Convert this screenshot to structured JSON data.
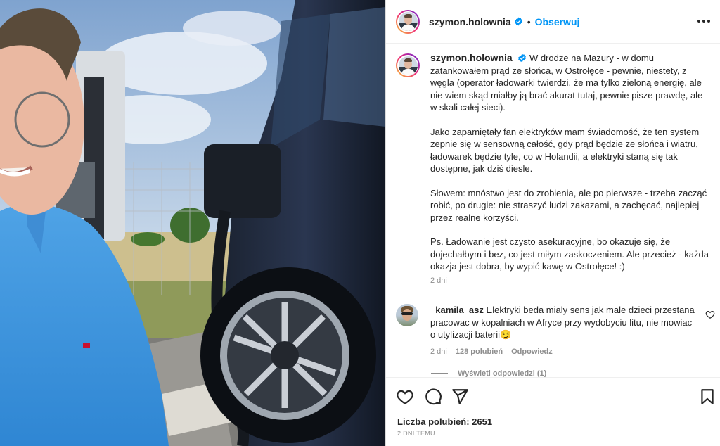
{
  "post": {
    "username": "szymon.holownia",
    "follow_label": "Obserwuj",
    "separator": "•",
    "caption_paragraphs": [
      "W drodze na Mazury - w domu zatankowałem prąd ze słońca, w Ostrołęce - pewnie, niestety, z węgla (operator ładowarki twierdzi, że ma tylko zieloną energię, ale nie wiem skąd miałby ją brać akurat tutaj, pewnie pisze prawdę, ale w skali całej sieci).",
      "Jako zapamiętały fan elektryków mam świadomość, że ten system zepnie się w sensowną całość, gdy prąd będzie ze słońca i wiatru, ładowarek będzie tyle, co w Holandii, a elektryki staną się tak dostępne, jak dziś diesle.",
      "Słowem: mnóstwo jest do zrobienia, ale po pierwsze - trzeba zacząć robić, po drugie: nie straszyć ludzi zakazami, a zachęcać, najlepiej przez realne korzyści.",
      "Ps. Ładowanie jest czysto asekuracyjne, bo okazuje się, że dojechałbym i bez, co jest miłym zaskoczeniem. Ale przecież - każda okazja jest dobra, by wypić kawę w Ostrołęce! :)"
    ],
    "caption_time": "2 dni",
    "likes_label": "Liczba polubień: 2651",
    "posted_ago": "2 DNI TEMU"
  },
  "comment": {
    "username": "_kamila_asz",
    "text": "Elektryki beda mialy sens jak male dzieci przestana pracowac w kopalniach w Afryce przy wydobyciu litu, nie mowiac o utylizacji baterii",
    "emoji": "😏",
    "time": "2 dni",
    "likes": "128 polubień",
    "reply_label": "Odpowiedz",
    "view_replies": "Wyświetl odpowiedzi (1)"
  },
  "icons": {
    "header": [
      "verified-badge-icon",
      "more-options-icon"
    ],
    "actions": [
      "heart-icon",
      "comment-icon",
      "share-icon",
      "bookmark-icon"
    ]
  },
  "colors": {
    "accent": "#0095f6",
    "text": "#262626",
    "secondary": "#8e8e8e"
  }
}
